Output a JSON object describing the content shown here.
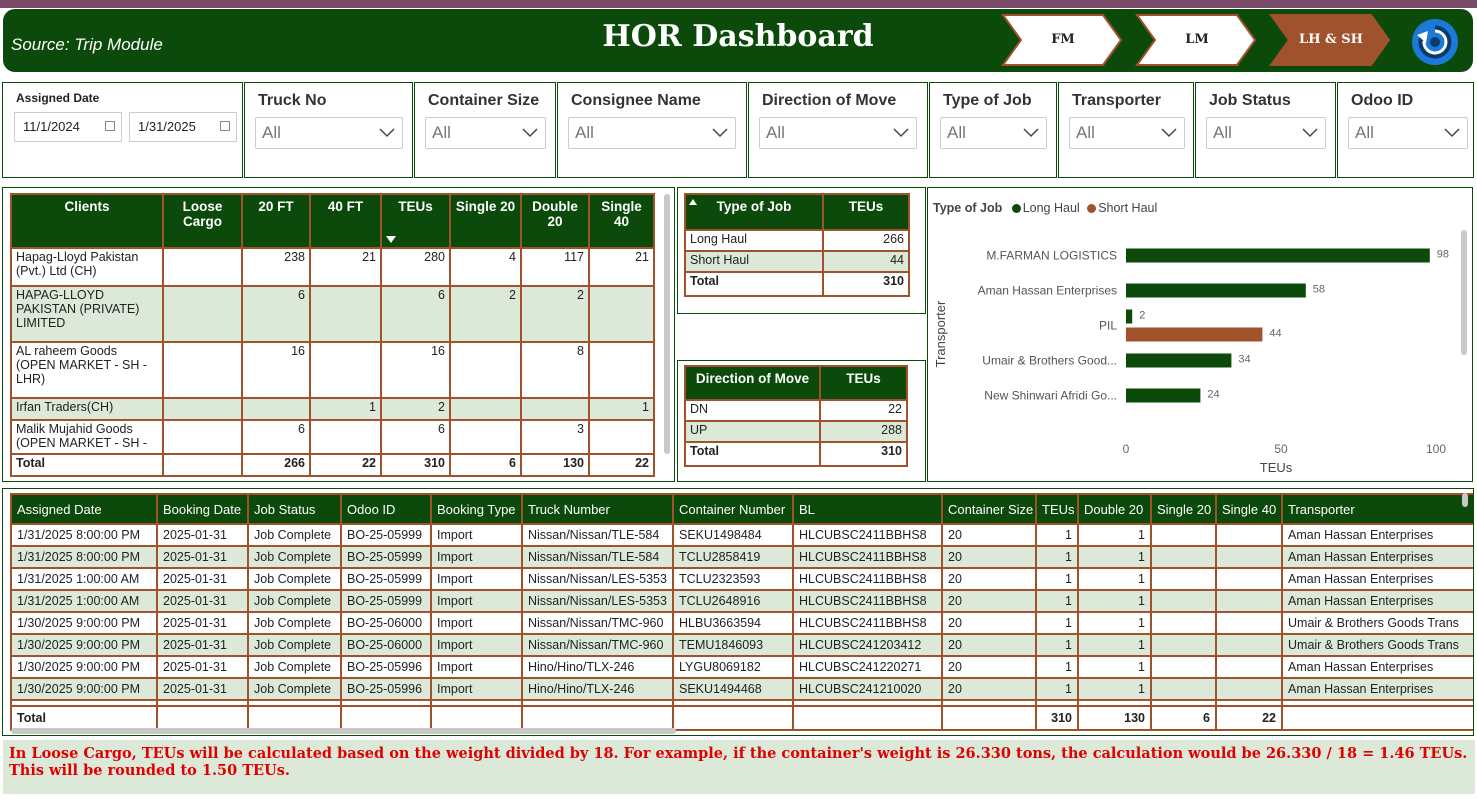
{
  "header": {
    "source": "Source: Trip Module",
    "title": "HOR Dashboard",
    "nav": [
      {
        "label": "FM",
        "active": false
      },
      {
        "label": "LM",
        "active": false
      },
      {
        "label": "LH & SH",
        "active": true
      }
    ]
  },
  "colors": {
    "primary": "#0b4a0b",
    "accent": "#a0522d",
    "row_alt": "#dce9d8",
    "note_text": "#e00000",
    "refresh_icon": "#1b7ad6"
  },
  "filters": {
    "assigned_date": {
      "label": "Assigned Date",
      "from": "11/1/2024",
      "to": "1/31/2025"
    },
    "dropdowns": [
      {
        "label": "Truck No",
        "value": "All"
      },
      {
        "label": "Container Size",
        "value": "All"
      },
      {
        "label": "Consignee Name",
        "value": "All"
      },
      {
        "label": "Direction of Move",
        "value": "All"
      },
      {
        "label": "Type of Job",
        "value": "All"
      },
      {
        "label": "Transporter",
        "value": "All"
      },
      {
        "label": "Job Status",
        "value": "All"
      },
      {
        "label": "Odoo ID",
        "value": "All"
      }
    ]
  },
  "clients_table": {
    "headers": [
      "Clients",
      "Loose Cargo",
      "20 FT",
      "40 FT",
      "TEUs",
      "Single 20",
      "Double 20",
      "Single 40"
    ],
    "rows": [
      [
        "Hapag-Lloyd Pakistan (Pvt.) Ltd (CH)",
        "",
        "238",
        "21",
        "280",
        "4",
        "117",
        "21"
      ],
      [
        "HAPAG-LLOYD PAKISTAN (PRIVATE) LIMITED",
        "",
        "6",
        "",
        "6",
        "2",
        "2",
        ""
      ],
      [
        "AL raheem Goods (OPEN MARKET - SH - LHR)",
        "",
        "16",
        "",
        "16",
        "",
        "8",
        ""
      ],
      [
        "Irfan Traders(CH)",
        "",
        "",
        "1",
        "2",
        "",
        "",
        "1"
      ],
      [
        "Malik Mujahid Goods (OPEN MARKET - SH -",
        "",
        "6",
        "",
        "6",
        "",
        "3",
        ""
      ]
    ],
    "total": [
      "Total",
      "",
      "266",
      "22",
      "310",
      "6",
      "130",
      "22"
    ]
  },
  "type_of_job_table": {
    "headers": [
      "Type of Job",
      "TEUs"
    ],
    "rows": [
      [
        "Long Haul",
        "266"
      ],
      [
        "Short Haul",
        "44"
      ]
    ],
    "total": [
      "Total",
      "310"
    ]
  },
  "direction_table": {
    "headers": [
      "Direction of Move",
      "TEUs"
    ],
    "rows": [
      [
        "DN",
        "22"
      ],
      [
        "UP",
        "288"
      ]
    ],
    "total": [
      "Total",
      "310"
    ]
  },
  "chart_data": {
    "type": "bar",
    "orientation": "horizontal",
    "legend_title": "Type of Job",
    "categories": [
      "M.FARMAN LOGISTICS",
      "Aman Hassan Enterprises",
      "PIL",
      "Umair & Brothers Good...",
      "New Shinwari Afridi Go..."
    ],
    "series": [
      {
        "name": "Long Haul",
        "color": "#0b4a0b",
        "values": [
          98,
          58,
          2,
          34,
          24
        ]
      },
      {
        "name": "Short Haul",
        "color": "#a0522d",
        "values": [
          null,
          null,
          44,
          null,
          null
        ]
      }
    ],
    "xlabel": "TEUs",
    "ylabel": "Transporter",
    "xlim": [
      0,
      100
    ],
    "xticks": [
      "0",
      "50",
      "100"
    ],
    "legend_position": "top-left",
    "grid": false
  },
  "detail_table": {
    "headers": [
      "Assigned Date",
      "Booking Date",
      "Job Status",
      "Odoo ID",
      "Booking Type",
      "Truck Number",
      "Container Number",
      "BL",
      "Container Size",
      "TEUs",
      "Double 20",
      "Single 20",
      "Single 40",
      "Transporter"
    ],
    "rows": [
      [
        "1/31/2025 8:00:00 PM",
        "2025-01-31",
        "Job Complete",
        "BO-25-05999",
        "Import",
        "Nissan/Nissan/TLE-584",
        "SEKU1498484",
        "HLCUBSC2411BBHS8",
        "20",
        "1",
        "1",
        "",
        "",
        "Aman Hassan Enterprises"
      ],
      [
        "1/31/2025 8:00:00 PM",
        "2025-01-31",
        "Job Complete",
        "BO-25-05999",
        "Import",
        "Nissan/Nissan/TLE-584",
        "TCLU2858419",
        "HLCUBSC2411BBHS8",
        "20",
        "1",
        "1",
        "",
        "",
        "Aman Hassan Enterprises"
      ],
      [
        "1/31/2025 1:00:00 AM",
        "2025-01-31",
        "Job Complete",
        "BO-25-05999",
        "Import",
        "Nissan/Nissan/LES-5353",
        "TCLU2323593",
        "HLCUBSC2411BBHS8",
        "20",
        "1",
        "1",
        "",
        "",
        "Aman Hassan Enterprises"
      ],
      [
        "1/31/2025 1:00:00 AM",
        "2025-01-31",
        "Job Complete",
        "BO-25-05999",
        "Import",
        "Nissan/Nissan/LES-5353",
        "TCLU2648916",
        "HLCUBSC2411BBHS8",
        "20",
        "1",
        "1",
        "",
        "",
        "Aman Hassan Enterprises"
      ],
      [
        "1/30/2025 9:00:00 PM",
        "2025-01-31",
        "Job Complete",
        "BO-25-06000",
        "Import",
        "Nissan/Nissan/TMC-960",
        "HLBU3663594",
        "HLCUBSC2411BBHS8",
        "20",
        "1",
        "1",
        "",
        "",
        "Umair & Brothers Goods Trans"
      ],
      [
        "1/30/2025 9:00:00 PM",
        "2025-01-31",
        "Job Complete",
        "BO-25-06000",
        "Import",
        "Nissan/Nissan/TMC-960",
        "TEMU1846093",
        "HLCUBSC241203412",
        "20",
        "1",
        "1",
        "",
        "",
        "Umair & Brothers Goods Trans"
      ],
      [
        "1/30/2025 9:00:00 PM",
        "2025-01-31",
        "Job Complete",
        "BO-25-05996",
        "Import",
        "Hino/Hino/TLX-246",
        "LYGU8069182",
        "HLCUBSC241220271",
        "20",
        "1",
        "1",
        "",
        "",
        "Aman Hassan Enterprises"
      ],
      [
        "1/30/2025 9:00:00 PM",
        "2025-01-31",
        "Job Complete",
        "BO-25-05996",
        "Import",
        "Hino/Hino/TLX-246",
        "SEKU1494468",
        "HLCUBSC241210020",
        "20",
        "1",
        "1",
        "",
        "",
        "Aman Hassan Enterprises"
      ]
    ],
    "total": [
      "Total",
      "",
      "",
      "",
      "",
      "",
      "",
      "",
      "",
      "310",
      "130",
      "6",
      "22",
      ""
    ]
  },
  "note": {
    "line1": "In Loose Cargo, TEUs will be calculated based on the weight divided by 18. For example, if the container's weight is 26.330 tons, the calculation would be 26.330 / 18 = 1.46 TEUs.",
    "line2": "This will be rounded to 1.50 TEUs."
  }
}
